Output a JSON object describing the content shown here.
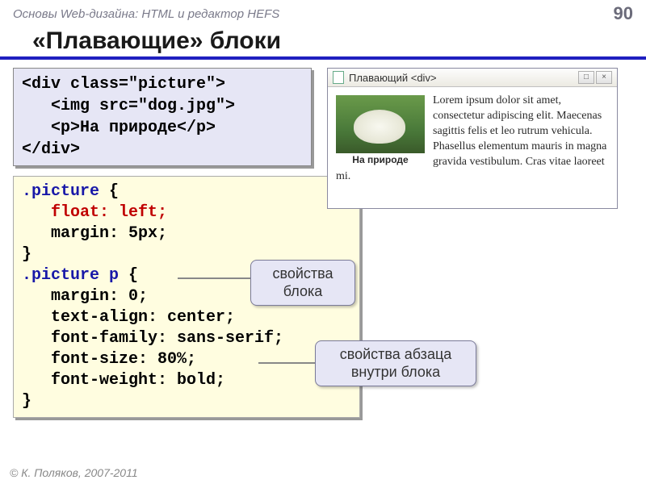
{
  "header": {
    "breadcrumb": "Основы Web-дизайна: HTML и редактор HEFS",
    "page_number": "90"
  },
  "title": "«Плавающие» блоки",
  "html_code": {
    "line1a": "<div class=\"picture\">",
    "line2": "   <img src=\"dog.jpg\">",
    "line3": "   <p>На природе</p>",
    "line4": "</div>"
  },
  "css_code": {
    "sel1": ".picture",
    "brace_o": " {",
    "float_kw": "   float: left;",
    "margin1": "   margin: 5px;",
    "brace_c": "}",
    "sel2": ".picture p",
    "margin0": "   margin: 0;",
    "ta": "   text-align: center;",
    "ff": "   font-family: sans-serif;",
    "fs": "   font-size: 80%;",
    "fw": "   font-weight: bold;"
  },
  "browser": {
    "title": "Плавающий <div>",
    "caption": "На природе",
    "lorem": "Lorem ipsum dolor sit amet, consectetur adipiscing elit. Maecenas sagittis felis et leo rutrum vehicula. Phasellus elementum mauris in magna gravida vestibulum. Cras vitae laoreet mi."
  },
  "callouts": {
    "c1": "свойства блока",
    "c2": "свойства абзаца внутри блока"
  },
  "footer": "© К. Поляков, 2007-2011"
}
